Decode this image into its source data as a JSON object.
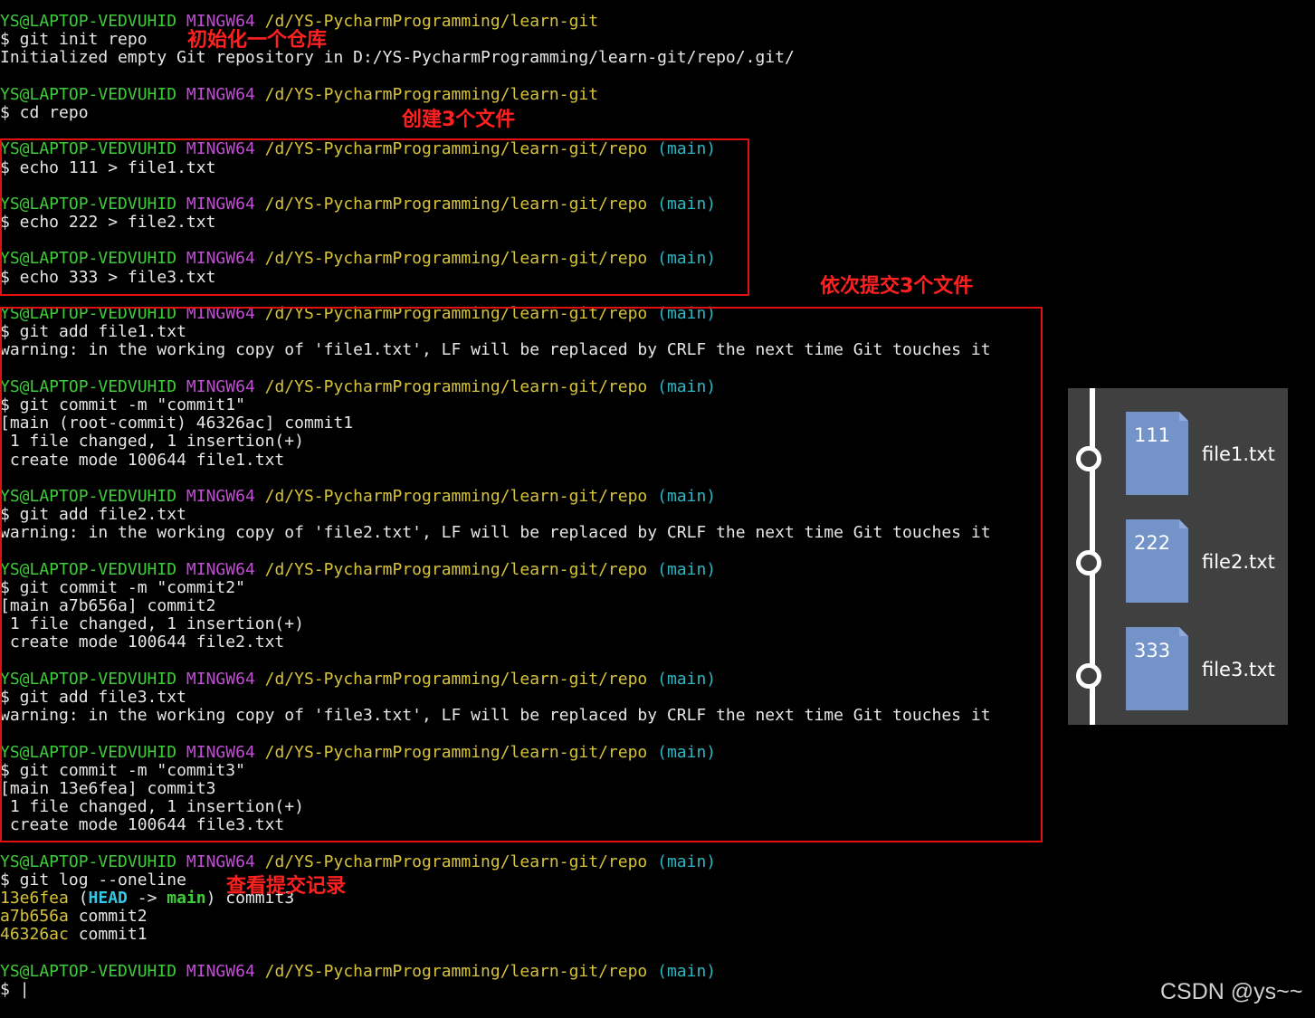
{
  "terminal": {
    "lines": [
      {
        "segs": [
          {
            "t": "YS@LAPTOP-VEDVUHID",
            "c": "user"
          },
          {
            "t": " "
          },
          {
            "t": "MINGW64",
            "c": "sys"
          },
          {
            "t": " "
          },
          {
            "t": "/d/YS-PycharmProgramming/learn-git",
            "c": "path"
          }
        ]
      },
      {
        "segs": [
          {
            "t": "$ git init repo"
          }
        ]
      },
      {
        "segs": [
          {
            "t": "Initialized empty Git repository in D:/YS-PycharmProgramming/learn-git/repo/.git/"
          }
        ]
      },
      {
        "segs": [
          {
            "t": ""
          }
        ]
      },
      {
        "segs": [
          {
            "t": "YS@LAPTOP-VEDVUHID",
            "c": "user"
          },
          {
            "t": " "
          },
          {
            "t": "MINGW64",
            "c": "sys"
          },
          {
            "t": " "
          },
          {
            "t": "/d/YS-PycharmProgramming/learn-git",
            "c": "path"
          }
        ]
      },
      {
        "segs": [
          {
            "t": "$ cd repo"
          }
        ]
      },
      {
        "segs": [
          {
            "t": ""
          }
        ]
      },
      {
        "segs": [
          {
            "t": "YS@LAPTOP-VEDVUHID",
            "c": "user"
          },
          {
            "t": " "
          },
          {
            "t": "MINGW64",
            "c": "sys"
          },
          {
            "t": " "
          },
          {
            "t": "/d/YS-PycharmProgramming/learn-git/repo",
            "c": "path"
          },
          {
            "t": " "
          },
          {
            "t": "(main)",
            "c": "branch"
          }
        ]
      },
      {
        "segs": [
          {
            "t": "$ echo 111 > file1.txt"
          }
        ]
      },
      {
        "segs": [
          {
            "t": ""
          }
        ]
      },
      {
        "segs": [
          {
            "t": "YS@LAPTOP-VEDVUHID",
            "c": "user"
          },
          {
            "t": " "
          },
          {
            "t": "MINGW64",
            "c": "sys"
          },
          {
            "t": " "
          },
          {
            "t": "/d/YS-PycharmProgramming/learn-git/repo",
            "c": "path"
          },
          {
            "t": " "
          },
          {
            "t": "(main)",
            "c": "branch"
          }
        ]
      },
      {
        "segs": [
          {
            "t": "$ echo 222 > file2.txt"
          }
        ]
      },
      {
        "segs": [
          {
            "t": ""
          }
        ]
      },
      {
        "segs": [
          {
            "t": "YS@LAPTOP-VEDVUHID",
            "c": "user"
          },
          {
            "t": " "
          },
          {
            "t": "MINGW64",
            "c": "sys"
          },
          {
            "t": " "
          },
          {
            "t": "/d/YS-PycharmProgramming/learn-git/repo",
            "c": "path"
          },
          {
            "t": " "
          },
          {
            "t": "(main)",
            "c": "branch"
          }
        ]
      },
      {
        "segs": [
          {
            "t": "$ echo 333 > file3.txt"
          }
        ]
      },
      {
        "segs": [
          {
            "t": ""
          }
        ]
      },
      {
        "segs": [
          {
            "t": "YS@LAPTOP-VEDVUHID",
            "c": "user"
          },
          {
            "t": " "
          },
          {
            "t": "MINGW64",
            "c": "sys"
          },
          {
            "t": " "
          },
          {
            "t": "/d/YS-PycharmProgramming/learn-git/repo",
            "c": "path"
          },
          {
            "t": " "
          },
          {
            "t": "(main)",
            "c": "branch"
          }
        ]
      },
      {
        "segs": [
          {
            "t": "$ git add file1.txt"
          }
        ]
      },
      {
        "segs": [
          {
            "t": "warning: in the working copy of 'file1.txt', LF will be replaced by CRLF the next time Git touches it"
          }
        ]
      },
      {
        "segs": [
          {
            "t": ""
          }
        ]
      },
      {
        "segs": [
          {
            "t": "YS@LAPTOP-VEDVUHID",
            "c": "user"
          },
          {
            "t": " "
          },
          {
            "t": "MINGW64",
            "c": "sys"
          },
          {
            "t": " "
          },
          {
            "t": "/d/YS-PycharmProgramming/learn-git/repo",
            "c": "path"
          },
          {
            "t": " "
          },
          {
            "t": "(main)",
            "c": "branch"
          }
        ]
      },
      {
        "segs": [
          {
            "t": "$ git commit -m \"commit1\""
          }
        ]
      },
      {
        "segs": [
          {
            "t": "[main (root-commit) 46326ac] commit1"
          }
        ]
      },
      {
        "segs": [
          {
            "t": " 1 file changed, 1 insertion(+)"
          }
        ]
      },
      {
        "segs": [
          {
            "t": " create mode 100644 file1.txt"
          }
        ]
      },
      {
        "segs": [
          {
            "t": ""
          }
        ]
      },
      {
        "segs": [
          {
            "t": "YS@LAPTOP-VEDVUHID",
            "c": "user"
          },
          {
            "t": " "
          },
          {
            "t": "MINGW64",
            "c": "sys"
          },
          {
            "t": " "
          },
          {
            "t": "/d/YS-PycharmProgramming/learn-git/repo",
            "c": "path"
          },
          {
            "t": " "
          },
          {
            "t": "(main)",
            "c": "branch"
          }
        ]
      },
      {
        "segs": [
          {
            "t": "$ git add file2.txt"
          }
        ]
      },
      {
        "segs": [
          {
            "t": "warning: in the working copy of 'file2.txt', LF will be replaced by CRLF the next time Git touches it"
          }
        ]
      },
      {
        "segs": [
          {
            "t": ""
          }
        ]
      },
      {
        "segs": [
          {
            "t": "YS@LAPTOP-VEDVUHID",
            "c": "user"
          },
          {
            "t": " "
          },
          {
            "t": "MINGW64",
            "c": "sys"
          },
          {
            "t": " "
          },
          {
            "t": "/d/YS-PycharmProgramming/learn-git/repo",
            "c": "path"
          },
          {
            "t": " "
          },
          {
            "t": "(main)",
            "c": "branch"
          }
        ]
      },
      {
        "segs": [
          {
            "t": "$ git commit -m \"commit2\""
          }
        ]
      },
      {
        "segs": [
          {
            "t": "[main a7b656a] commit2"
          }
        ]
      },
      {
        "segs": [
          {
            "t": " 1 file changed, 1 insertion(+)"
          }
        ]
      },
      {
        "segs": [
          {
            "t": " create mode 100644 file2.txt"
          }
        ]
      },
      {
        "segs": [
          {
            "t": ""
          }
        ]
      },
      {
        "segs": [
          {
            "t": "YS@LAPTOP-VEDVUHID",
            "c": "user"
          },
          {
            "t": " "
          },
          {
            "t": "MINGW64",
            "c": "sys"
          },
          {
            "t": " "
          },
          {
            "t": "/d/YS-PycharmProgramming/learn-git/repo",
            "c": "path"
          },
          {
            "t": " "
          },
          {
            "t": "(main)",
            "c": "branch"
          }
        ]
      },
      {
        "segs": [
          {
            "t": "$ git add file3.txt"
          }
        ]
      },
      {
        "segs": [
          {
            "t": "warning: in the working copy of 'file3.txt', LF will be replaced by CRLF the next time Git touches it"
          }
        ]
      },
      {
        "segs": [
          {
            "t": ""
          }
        ]
      },
      {
        "segs": [
          {
            "t": "YS@LAPTOP-VEDVUHID",
            "c": "user"
          },
          {
            "t": " "
          },
          {
            "t": "MINGW64",
            "c": "sys"
          },
          {
            "t": " "
          },
          {
            "t": "/d/YS-PycharmProgramming/learn-git/repo",
            "c": "path"
          },
          {
            "t": " "
          },
          {
            "t": "(main)",
            "c": "branch"
          }
        ]
      },
      {
        "segs": [
          {
            "t": "$ git commit -m \"commit3\""
          }
        ]
      },
      {
        "segs": [
          {
            "t": "[main 13e6fea] commit3"
          }
        ]
      },
      {
        "segs": [
          {
            "t": " 1 file changed, 1 insertion(+)"
          }
        ]
      },
      {
        "segs": [
          {
            "t": " create mode 100644 file3.txt"
          }
        ]
      },
      {
        "segs": [
          {
            "t": ""
          }
        ]
      },
      {
        "segs": [
          {
            "t": "YS@LAPTOP-VEDVUHID",
            "c": "user"
          },
          {
            "t": " "
          },
          {
            "t": "MINGW64",
            "c": "sys"
          },
          {
            "t": " "
          },
          {
            "t": "/d/YS-PycharmProgramming/learn-git/repo",
            "c": "path"
          },
          {
            "t": " "
          },
          {
            "t": "(main)",
            "c": "branch"
          }
        ]
      },
      {
        "segs": [
          {
            "t": "$ git log --oneline"
          }
        ]
      },
      {
        "segs": [
          {
            "t": "13e6fea",
            "c": "hash"
          },
          {
            "t": " ("
          },
          {
            "t": "HEAD",
            "c": "head"
          },
          {
            "t": " -> ",
            "c": "arrow"
          },
          {
            "t": "main",
            "c": "mainref"
          },
          {
            "t": ") commit3"
          }
        ]
      },
      {
        "segs": [
          {
            "t": "a7b656a",
            "c": "hash"
          },
          {
            "t": " commit2"
          }
        ]
      },
      {
        "segs": [
          {
            "t": "46326ac",
            "c": "hash"
          },
          {
            "t": " commit1"
          }
        ]
      },
      {
        "segs": [
          {
            "t": ""
          }
        ]
      },
      {
        "segs": [
          {
            "t": "YS@LAPTOP-VEDVUHID",
            "c": "user"
          },
          {
            "t": " "
          },
          {
            "t": "MINGW64",
            "c": "sys"
          },
          {
            "t": " "
          },
          {
            "t": "/d/YS-PycharmProgramming/learn-git/repo",
            "c": "path"
          },
          {
            "t": " "
          },
          {
            "t": "(main)",
            "c": "branch"
          }
        ]
      },
      {
        "segs": [
          {
            "t": "$ "
          },
          {
            "t": "|",
            "c": "cursor"
          }
        ]
      }
    ]
  },
  "annotations": {
    "init": "初始化一个仓库",
    "create": "创建3个文件",
    "commit": "依次提交3个文件",
    "log": "查看提交记录"
  },
  "diagram": {
    "files": [
      {
        "content": "111",
        "name": "file1.txt"
      },
      {
        "content": "222",
        "name": "file2.txt"
      },
      {
        "content": "333",
        "name": "file3.txt"
      }
    ]
  },
  "watermark": "CSDN @ys~~",
  "colors": {
    "user": "#3fcc3a",
    "system": "#c04fd4",
    "path": "#d6c33a",
    "branch": "#2fb6c2",
    "annotation": "#ff2020",
    "file_icon": "#7393c9",
    "panel": "#404040"
  }
}
